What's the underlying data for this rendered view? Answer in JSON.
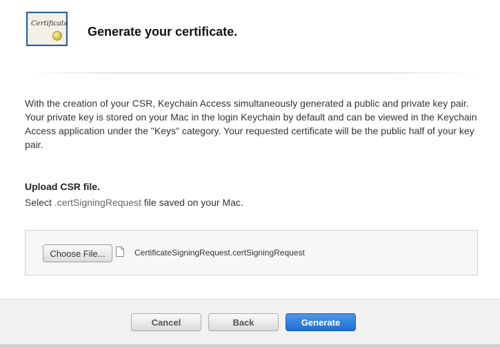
{
  "header": {
    "title": "Generate your certificate.",
    "icon_text": "Certificate"
  },
  "intro": {
    "text": "With the creation of your CSR, Keychain Access simultaneously generated a public and private key pair. Your private key is stored on your Mac in the login Keychain by default and can be viewed in the Keychain Access application under the \"Keys\" category. Your requested certificate will be the public half of your key pair."
  },
  "upload": {
    "title": "Upload CSR file.",
    "desc_prefix": "Select ",
    "desc_ext": ".certSigningRequest",
    "desc_suffix": " file saved on your Mac.",
    "choose_label": "Choose File...",
    "file_name": "CertificateSigningRequest.certSigningRequest"
  },
  "footer": {
    "cancel_label": "Cancel",
    "back_label": "Back",
    "generate_label": "Generate"
  },
  "colors": {
    "primary_button": "#1f6fcf",
    "icon_border": "#2e5e9a"
  }
}
